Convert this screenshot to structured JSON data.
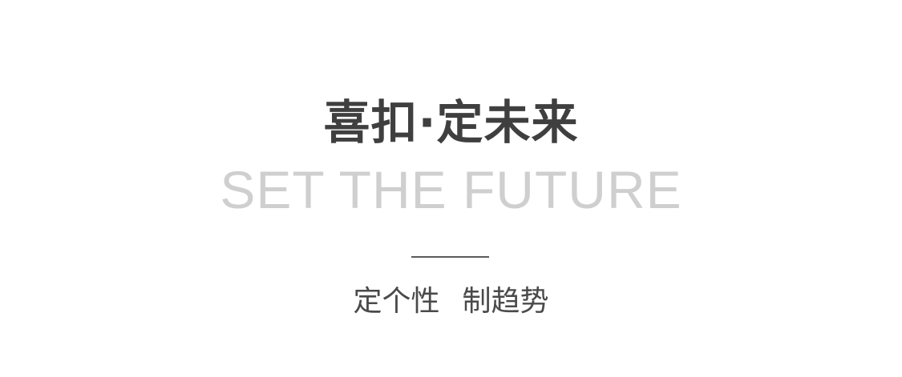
{
  "banner": {
    "title": "喜扣·定未来",
    "subtitle": "SET THE FUTURE",
    "tagline_left": "定个性",
    "tagline_right": "制趋势"
  },
  "colors": {
    "title": "#3f3f3f",
    "subtitle": "#cfcfcf",
    "divider": "#5a5a5a",
    "tagline": "#4a4a4a",
    "background": "#ffffff"
  }
}
